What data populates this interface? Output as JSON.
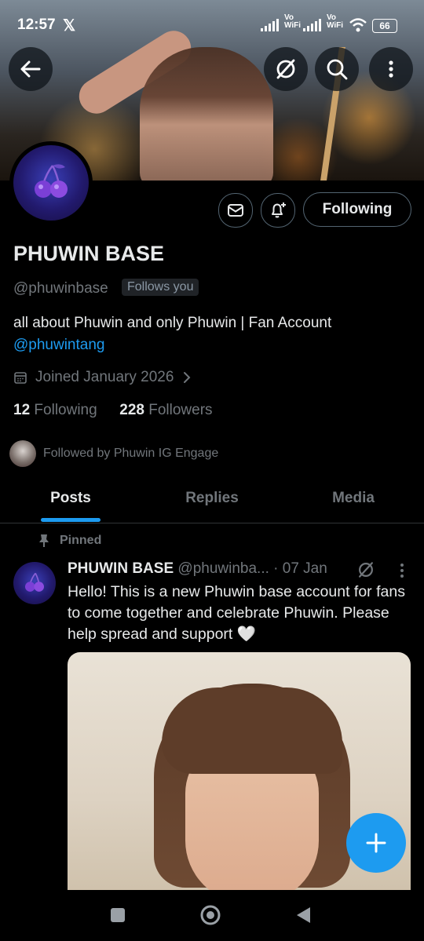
{
  "status_bar": {
    "time": "12:57",
    "app_glyph": "𝕏",
    "network1_label": "Vo WiFi",
    "network2_label": "Vo WiFi",
    "battery": "66"
  },
  "header": {
    "back_icon": "arrow-left-icon",
    "grok_icon": "grok-icon",
    "search_icon": "search-icon",
    "more_icon": "more-vertical-icon"
  },
  "profile": {
    "name": "PHUWIN BASE",
    "handle": "@phuwinbase",
    "follows_you": "Follows you",
    "bio": "all about Phuwin and only Phuwin | Fan Account",
    "bio_link": "@phuwintang",
    "joined": "Joined January 2026",
    "following_count": "12",
    "following_label": "Following",
    "followers_count": "228",
    "followers_label": "Followers",
    "followed_by": "Followed by Phuwin IG Engage",
    "follow_button": "Following"
  },
  "tabs": [
    {
      "label": "Posts",
      "active": true
    },
    {
      "label": "Replies",
      "active": false
    },
    {
      "label": "Media",
      "active": false
    }
  ],
  "pinned_post": {
    "pinned_label": "Pinned",
    "author_name": "PHUWIN BASE",
    "author_handle": "@phuwinba...",
    "date": "· 07 Jan",
    "text": "Hello! This is a new Phuwin base account for fans to come together and celebrate Phuwin. Please help spread and support 🤍"
  },
  "colors": {
    "accent": "#1d9bf0",
    "background": "#000000",
    "text": "#e7e9ea",
    "muted": "#71767b"
  }
}
